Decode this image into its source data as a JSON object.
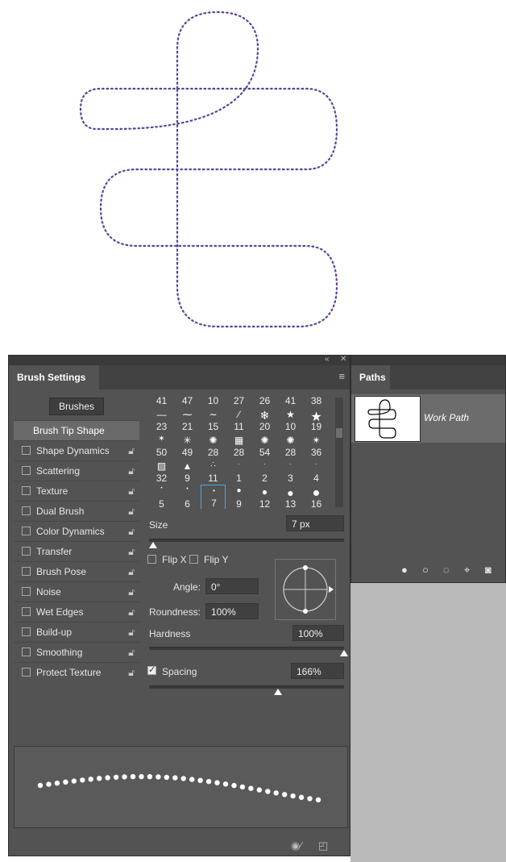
{
  "brush_panel": {
    "tab_title": "Brush Settings",
    "brushes_button": "Brushes",
    "menu_icon": "hamburger-icon",
    "collapse_icon": "double-chevron-icon",
    "close_icon": "close-icon",
    "list": [
      {
        "label": "Brush Tip Shape",
        "active": true
      },
      {
        "label": "Shape Dynamics"
      },
      {
        "label": "Scattering"
      },
      {
        "label": "Texture"
      },
      {
        "label": "Dual Brush"
      },
      {
        "label": "Color Dynamics"
      },
      {
        "label": "Transfer"
      },
      {
        "label": "Brush Pose"
      },
      {
        "label": "Noise"
      },
      {
        "label": "Wet Edges"
      },
      {
        "label": "Build-up"
      },
      {
        "label": "Smoothing"
      },
      {
        "label": "Protect Texture"
      }
    ],
    "grid": {
      "top_numbers": [
        "41",
        "47",
        "10",
        "27",
        "26",
        "41",
        "38"
      ],
      "rows": [
        [
          "23",
          "21",
          "15",
          "11",
          "20",
          "10",
          "19"
        ],
        [
          "50",
          "49",
          "28",
          "28",
          "54",
          "28",
          "36"
        ],
        [
          "32",
          "9",
          "11",
          "1",
          "2",
          "3",
          "4"
        ],
        [
          "5",
          "6",
          "7",
          "9",
          "12",
          "13",
          "16"
        ]
      ],
      "selected": "7"
    },
    "size_label": "Size",
    "size_value": "7 px",
    "flip_x": "Flip X",
    "flip_y": "Flip Y",
    "angle_label": "Angle:",
    "angle_value": "0°",
    "roundness_label": "Roundness:",
    "roundness_value": "100%",
    "hardness_label": "Hardness",
    "hardness_value": "100%",
    "spacing_label": "Spacing",
    "spacing_value": "166%",
    "spacing_checked": true,
    "size_slider_level": 0.02,
    "hardness_slider_level": 1.0,
    "spacing_slider_level": 0.66
  },
  "paths_panel": {
    "tab_title": "Paths",
    "item_label": "Work Path"
  },
  "colors": {
    "panel_bg": "#535353",
    "selected_border": "#4fa9e0",
    "path_stroke_red": "#c0344a",
    "path_stroke_blue": "#3c4aa8"
  }
}
